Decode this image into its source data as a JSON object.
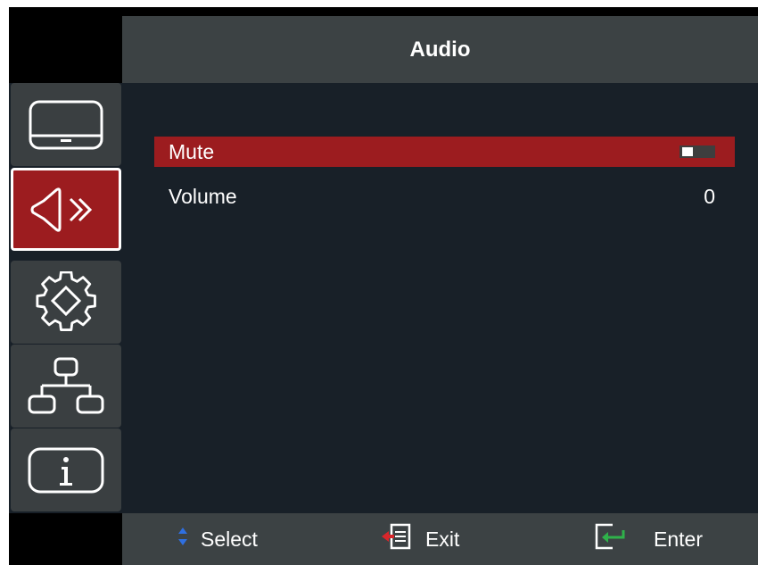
{
  "header": {
    "title": "Audio"
  },
  "sidebar": {
    "items": [
      {
        "icon": "display-icon",
        "active": false
      },
      {
        "icon": "audio-speaker-icon",
        "active": true
      },
      {
        "icon": "gear-settings-icon",
        "active": false
      },
      {
        "icon": "network-icon",
        "active": false
      },
      {
        "icon": "info-icon",
        "active": false
      }
    ]
  },
  "menu": {
    "rows": [
      {
        "label": "Mute",
        "control": "toggle",
        "state": "off",
        "selected": true
      },
      {
        "label": "Volume",
        "value": "0",
        "selected": false
      }
    ]
  },
  "footer": {
    "select_label": "Select",
    "exit_label": "Exit",
    "enter_label": "Enter"
  },
  "colors": {
    "accent": "#9c1c1f",
    "panel": "#182028",
    "bar": "#3c4244",
    "tab": "#3a3f41",
    "enter_arrow": "#2fb24a",
    "exit_arrow": "#d8262b",
    "select_arrows": "#2f6fe0"
  }
}
